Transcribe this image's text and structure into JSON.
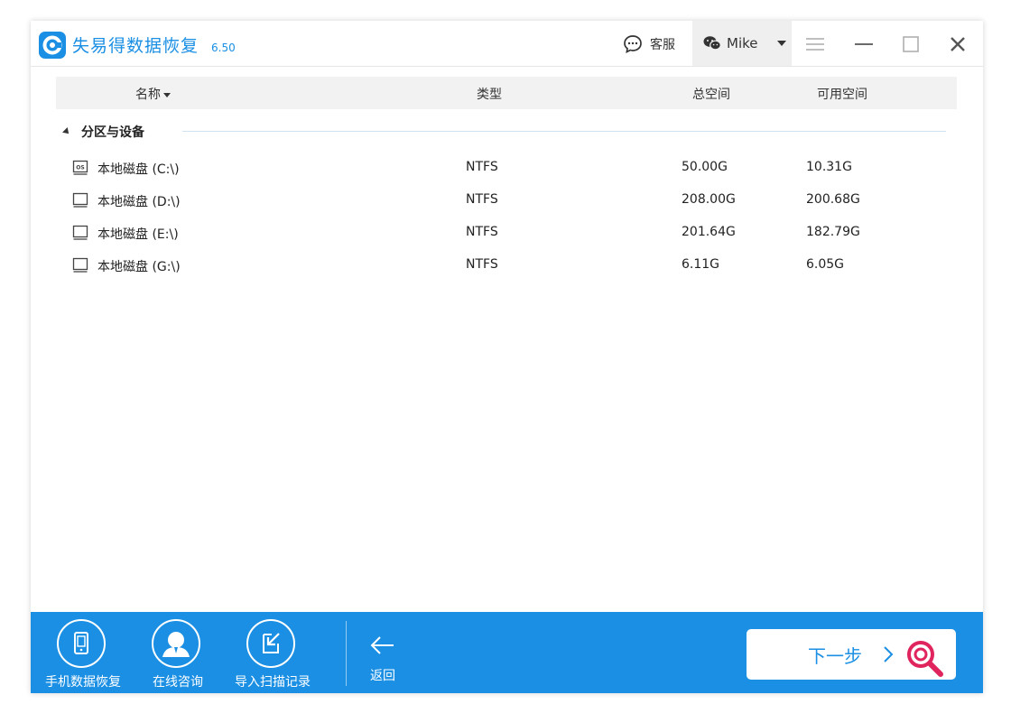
{
  "app": {
    "title": "失易得数据恢复",
    "version": "6.50",
    "brand_color": "#1a8fe3"
  },
  "titlebar": {
    "support_label": "客服",
    "user_name": "Mike",
    "icons": [
      "chat-bubble-icon",
      "wechat-icon",
      "caret-down-icon",
      "menu-icon",
      "minimize-icon",
      "maximize-icon",
      "close-icon"
    ]
  },
  "table": {
    "headers": {
      "name": "名称",
      "type": "类型",
      "total": "总空间",
      "free": "可用空间"
    },
    "group_label": "分区与设备",
    "rows": [
      {
        "name": "本地磁盘 (C:\\)",
        "type": "NTFS",
        "total": "50.00G",
        "free": "10.31G",
        "icon": "os-drive-icon"
      },
      {
        "name": "本地磁盘 (D:\\)",
        "type": "NTFS",
        "total": "208.00G",
        "free": "200.68G",
        "icon": "drive-icon"
      },
      {
        "name": "本地磁盘 (E:\\)",
        "type": "NTFS",
        "total": "201.64G",
        "free": "182.79G",
        "icon": "drive-icon"
      },
      {
        "name": "本地磁盘 (G:\\)",
        "type": "NTFS",
        "total": "6.11G",
        "free": "6.05G",
        "icon": "drive-icon"
      }
    ]
  },
  "bottom": {
    "phone_recovery": "手机数据恢复",
    "online_consult": "在线咨询",
    "import_scan": "导入扫描记录",
    "back": "返回",
    "next": "下一步"
  }
}
